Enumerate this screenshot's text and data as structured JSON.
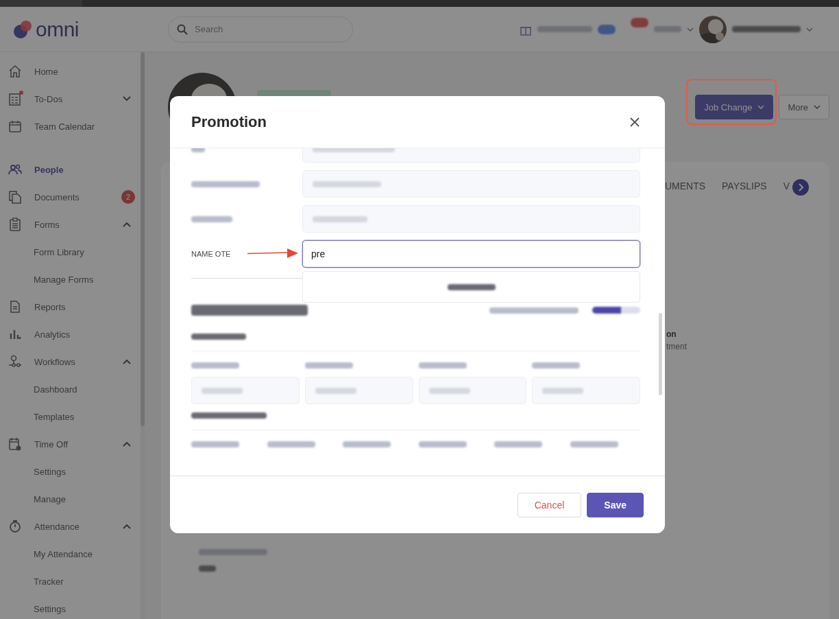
{
  "topbar": {
    "logo": "omni",
    "search": {
      "placeholder": "Search"
    }
  },
  "sidebar": {
    "sections": [
      [
        {
          "label": "Home",
          "selected": false
        },
        {
          "label": "To-Dos",
          "selected": false,
          "expanded": false,
          "alert": true
        },
        {
          "label": "Team Calendar",
          "selected": false
        }
      ],
      [
        {
          "label": "People",
          "selected": true
        },
        {
          "label": "Documents",
          "selected": false,
          "badge": "2"
        },
        {
          "label": "Forms",
          "selected": false,
          "expanded": true,
          "children": [
            {
              "label": "Form Library",
              "selected": false
            },
            {
              "label": "Manage Forms",
              "selected": false
            }
          ]
        },
        {
          "label": "Reports",
          "selected": false
        },
        {
          "label": "Analytics",
          "selected": false
        },
        {
          "label": "Workflows",
          "selected": false,
          "expanded": true,
          "children": [
            {
              "label": "Dashboard",
              "selected": false
            },
            {
              "label": "Templates",
              "selected": false
            }
          ]
        },
        {
          "label": "Time Off",
          "selected": false,
          "expanded": true,
          "children": [
            {
              "label": "Settings",
              "selected": false
            },
            {
              "label": "Manage",
              "selected": false
            }
          ]
        },
        {
          "label": "Attendance",
          "selected": false,
          "expanded": true,
          "children": [
            {
              "label": "My Attendance",
              "selected": false
            },
            {
              "label": "Tracker",
              "selected": false
            },
            {
              "label": "Settings",
              "selected": false
            }
          ]
        }
      ]
    ]
  },
  "page": {
    "actions": [
      {
        "label": "Job Change",
        "kind": "primary",
        "highlighted": true
      },
      {
        "label": "More",
        "kind": "secondary",
        "highlighted": false
      }
    ],
    "tabs": [
      {
        "label": "UMENTS",
        "selected": false
      },
      {
        "label": "PAYSLIPS",
        "selected": false
      },
      {
        "label": "V",
        "selected": false
      }
    ],
    "cut_texts": [
      "on",
      "tment"
    ]
  },
  "modal": {
    "title": "Promotion",
    "field": {
      "label": "NAME OTE",
      "value": "pre",
      "focused": true
    },
    "buttons": [
      {
        "label": "Cancel",
        "kind": "secondary"
      },
      {
        "label": "Save",
        "kind": "primary"
      }
    ]
  }
}
